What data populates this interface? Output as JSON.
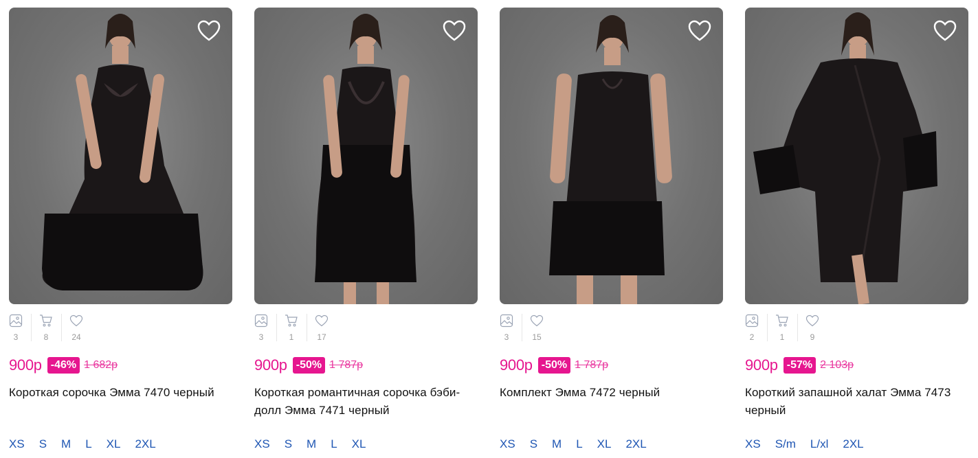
{
  "products": [
    {
      "photos": "3",
      "cart": "8",
      "favorites": "24",
      "price": "900р",
      "discount": "-46%",
      "old_price": "1 682р",
      "title": "Короткая сорочка Эмма 7470 черный",
      "sizes": [
        "XS",
        "S",
        "M",
        "L",
        "XL",
        "2XL"
      ]
    },
    {
      "photos": "3",
      "cart": "1",
      "favorites": "17",
      "price": "900р",
      "discount": "-50%",
      "old_price": "1 787р",
      "title": "Короткая романтичная сорочка бэби-долл Эмма 7471 черный",
      "sizes": [
        "XS",
        "S",
        "M",
        "L",
        "XL"
      ]
    },
    {
      "photos": "3",
      "cart": null,
      "favorites": "15",
      "price": "900р",
      "discount": "-50%",
      "old_price": "1 787р",
      "title": "Комплект Эмма 7472 черный",
      "sizes": [
        "XS",
        "S",
        "M",
        "L",
        "XL",
        "2XL"
      ]
    },
    {
      "photos": "2",
      "cart": "1",
      "favorites": "9",
      "price": "900р",
      "discount": "-57%",
      "old_price": "2 103р",
      "title": "Короткий запашной халат Эмма 7473 черный",
      "sizes": [
        "XS",
        "S/m",
        "L/xl",
        "2XL"
      ]
    }
  ],
  "icons": {
    "favorite": "heart-icon",
    "photos": "image-icon",
    "cart": "cart-icon",
    "likes": "heart-outline-icon"
  },
  "colors": {
    "accent": "#e6168f",
    "size_link": "#1f56b3",
    "stat_text": "#9a9a9a"
  }
}
